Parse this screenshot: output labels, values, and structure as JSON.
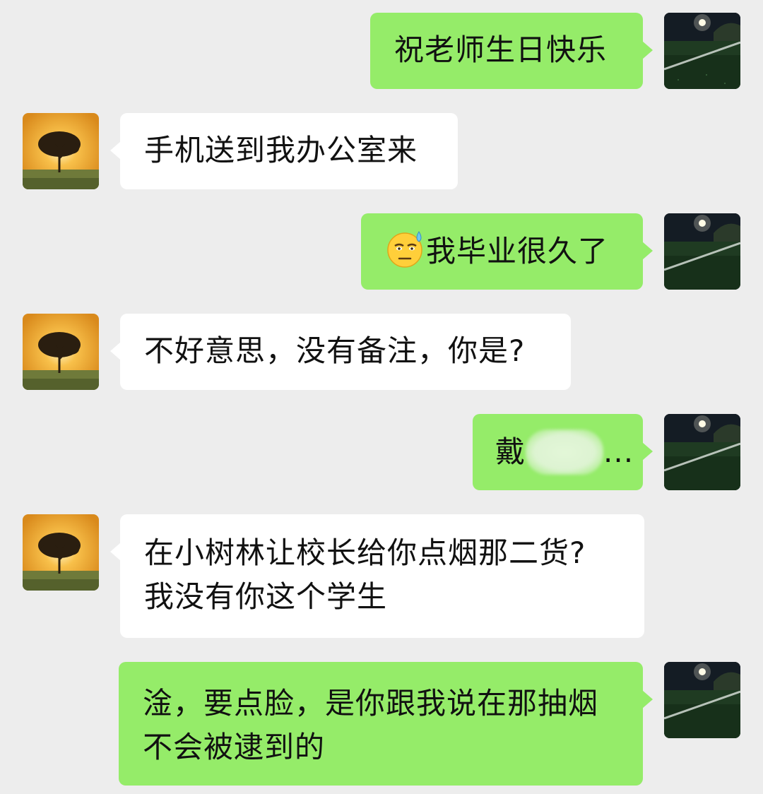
{
  "messages": [
    {
      "side": "out",
      "text": "祝老师生日快乐"
    },
    {
      "side": "in",
      "text": "手机送到我办公室来"
    },
    {
      "side": "out",
      "emoji": "sweat-smile-emoji",
      "text": "我毕业很久了"
    },
    {
      "side": "in",
      "text": "不好意思，没有备注，你是?"
    },
    {
      "side": "out",
      "text_start": "戴",
      "redacted": true,
      "text_end": "..."
    },
    {
      "side": "in",
      "line1": "在小树林让校长给你点烟那二货?",
      "line2": "我没有你这个学生"
    },
    {
      "side": "out",
      "line1": "淦，要点脸，是你跟我说在那抽烟",
      "line2": "不会被逮到的"
    }
  ],
  "colors": {
    "background": "#ededed",
    "outgoing_bubble": "#95ec69",
    "incoming_bubble": "#ffffff",
    "text": "#111111"
  },
  "avatars": {
    "self": "night-football-field-avatar",
    "teacher": "sunset-tree-avatar"
  }
}
